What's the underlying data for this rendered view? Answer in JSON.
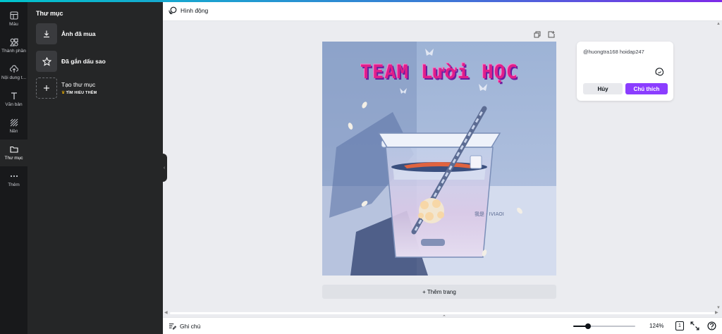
{
  "rail": {
    "items": [
      {
        "label": "Mẫu",
        "icon": "layout-icon"
      },
      {
        "label": "Thành phần",
        "icon": "elements-icon"
      },
      {
        "label": "Nội dung t...",
        "icon": "upload-cloud-icon"
      },
      {
        "label": "Văn bản",
        "icon": "text-icon"
      },
      {
        "label": "Nền",
        "icon": "background-icon"
      },
      {
        "label": "Thư mục",
        "icon": "folder-icon"
      },
      {
        "label": "Thêm",
        "icon": "more-icon"
      }
    ]
  },
  "panel": {
    "title": "Thư mục",
    "purchased": "Ảnh đã mua",
    "starred": "Đã gắn dấu sao",
    "create_folder": "Tạo thư mục",
    "learn_more": "TÌM HIỂU THÊM"
  },
  "toolbar": {
    "animate_label": "Hình động"
  },
  "design": {
    "title": "TEAM Lười HỌC"
  },
  "add_page": "+ Thêm trang",
  "comment": {
    "text": "@huongtra168 hoidap247",
    "cancel": "Hủy",
    "submit": "Chú thích"
  },
  "bottom": {
    "notes": "Ghi chú",
    "zoom": "124%",
    "zoom_fraction": 0.24,
    "page_count": "1"
  },
  "colors": {
    "accent": "#8b3dff",
    "title_pink": "#e01e8a"
  }
}
